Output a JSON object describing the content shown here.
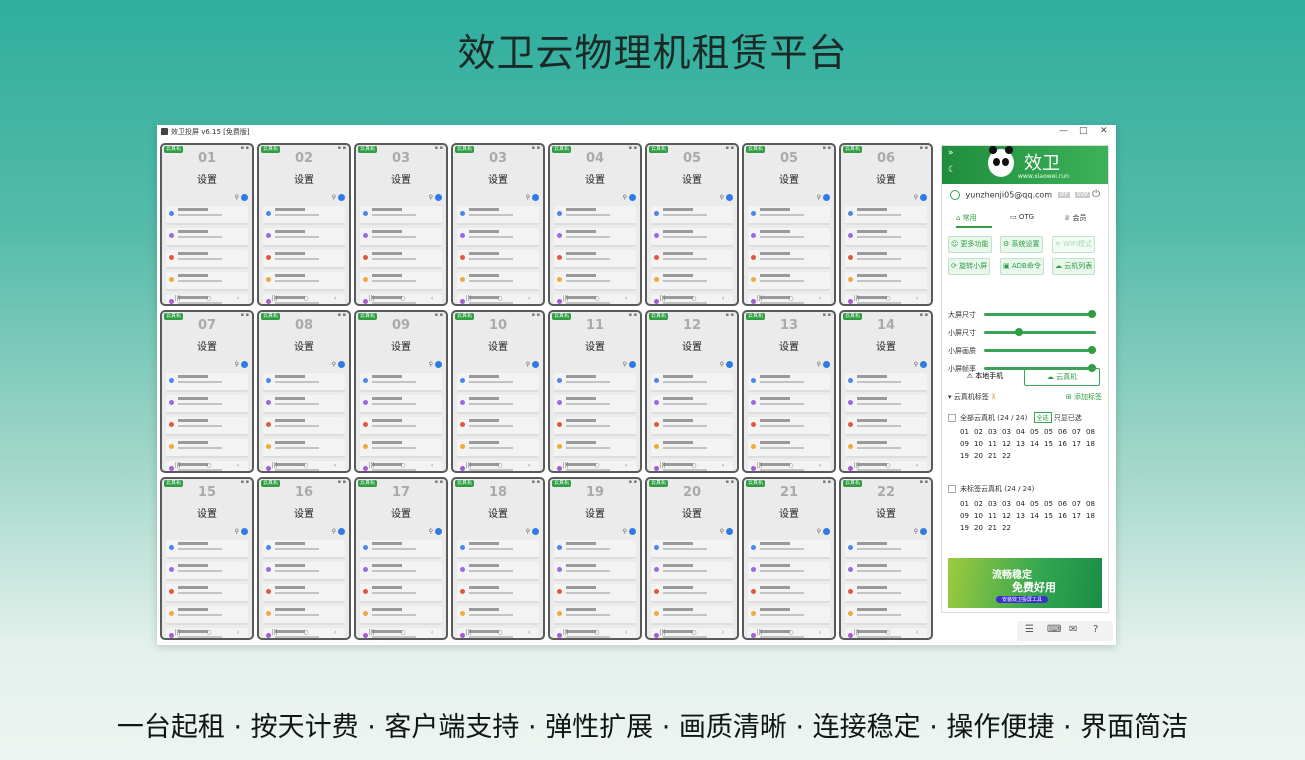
{
  "headline": "效卫云物理机租赁平台",
  "tagline": "一台起租 · 按天计费 · 客户端支持 · 弹性扩展 · 画质清晰 · 连接稳定 · 操作便捷 · 界面简洁",
  "window": {
    "title": "效卫投屏 v6.15 [免费版]",
    "minimize": "—",
    "maximize": "□",
    "close": "✕"
  },
  "phone_badge": "云真机",
  "phone_title": "设置",
  "phones": [
    "01",
    "02",
    "03",
    "03",
    "04",
    "05",
    "05",
    "06",
    "07",
    "08",
    "09",
    "10",
    "11",
    "12",
    "13",
    "14",
    "15",
    "16",
    "17",
    "18",
    "19",
    "20",
    "21",
    "22"
  ],
  "panel": {
    "brand_name": "效卫",
    "brand_url": "www.xiaowei.run",
    "user_email": "yunzhenji05@qq.com",
    "user_badges": [
      "VIP",
      "SVIP"
    ],
    "tabs": [
      "常用",
      "OTG",
      "会员"
    ],
    "buttons": [
      "更多功能",
      "系统设置",
      "WIFI模式",
      "旋转小屏",
      "ADB命令",
      "云机列表"
    ],
    "sliders": [
      {
        "label": "大屏尺寸",
        "value": 1.0
      },
      {
        "label": "小屏尺寸",
        "value": 0.3
      },
      {
        "label": "小屏画质",
        "value": 1.0
      },
      {
        "label": "小屏帧率",
        "value": 1.0
      }
    ],
    "device_tabs": [
      "本地手机",
      "云真机"
    ],
    "group_title": "云真机标签",
    "group_add": "添加标签",
    "group_all": "全部云真机 (24 / 24)",
    "select_all": "全选",
    "show_selected": "只显已选",
    "group_untagged": "未标签云真机 (24 / 24)",
    "numbers": [
      "01",
      "02",
      "03",
      "03",
      "04",
      "05",
      "05",
      "06",
      "07",
      "08",
      "09",
      "10",
      "11",
      "12",
      "13",
      "14",
      "15",
      "16",
      "17",
      "18",
      "19",
      "20",
      "21",
      "22"
    ],
    "banner_line1": "流畅稳定",
    "banner_line2": "免费好用",
    "banner_pill": "安装效卫投屏工具"
  },
  "colors": {
    "brand_green": "#2f9e43",
    "badge_green": "#2f9e43",
    "account_blue": "#2e7be6"
  }
}
